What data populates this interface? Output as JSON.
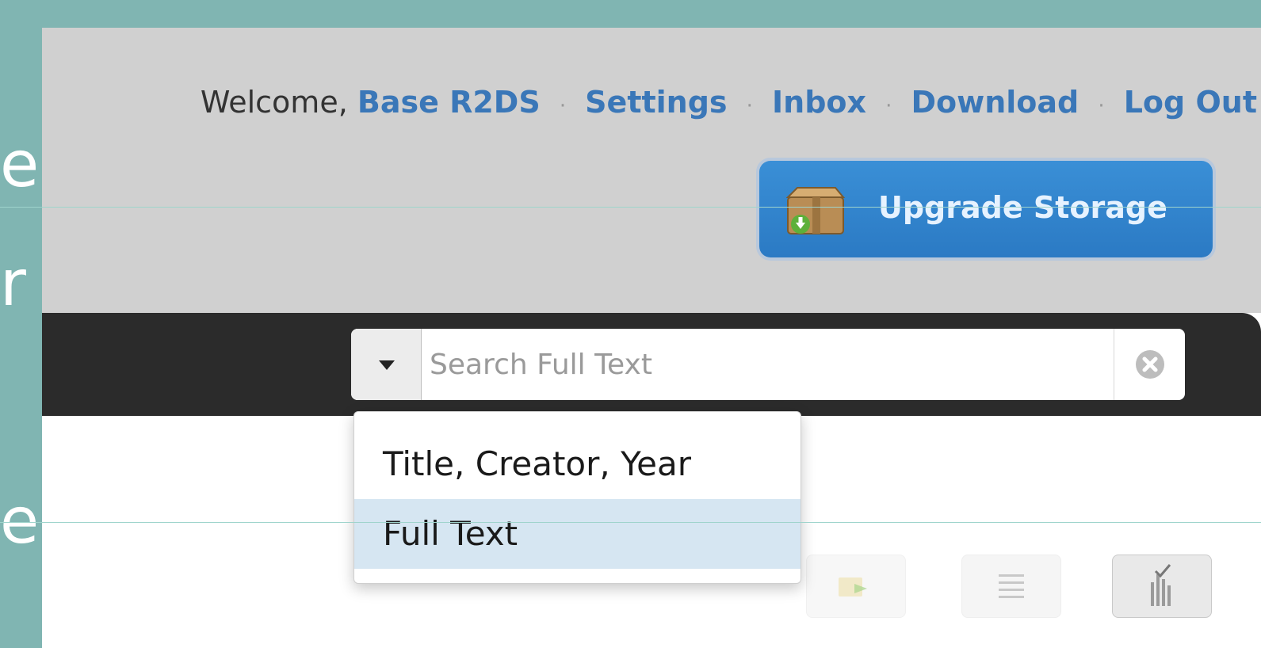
{
  "slide_fragments": [
    "e",
    "r",
    "e,"
  ],
  "header": {
    "welcome_text": "Welcome,",
    "user_name": "Base R2DS",
    "links": {
      "settings": "Settings",
      "inbox": "Inbox",
      "download": "Download",
      "logout": "Log Out"
    },
    "separator": "·",
    "upgrade_label": "Upgrade Storage",
    "upgrade_icon": "storage-box-icon"
  },
  "search": {
    "placeholder": "Search Full Text",
    "value": "",
    "toggle_icon": "caret-down-icon",
    "clear_icon": "clear-circle-icon"
  },
  "search_type_menu": {
    "items": [
      {
        "label": "Title, Creator, Year",
        "selected": false
      },
      {
        "label": "Full Text",
        "selected": true
      }
    ]
  },
  "toolbar_actions": [
    {
      "icon": "add-to-collection-icon"
    },
    {
      "icon": "list-view-icon"
    },
    {
      "icon": "column-chart-icon"
    }
  ],
  "colors": {
    "background": "#80b5b2",
    "header": "#d0d0d0",
    "link": "#3a77b8",
    "upgrade_button": "#2f82cc",
    "toolbar": "#2b2b2b",
    "selected_item": "#d6e6f2"
  }
}
